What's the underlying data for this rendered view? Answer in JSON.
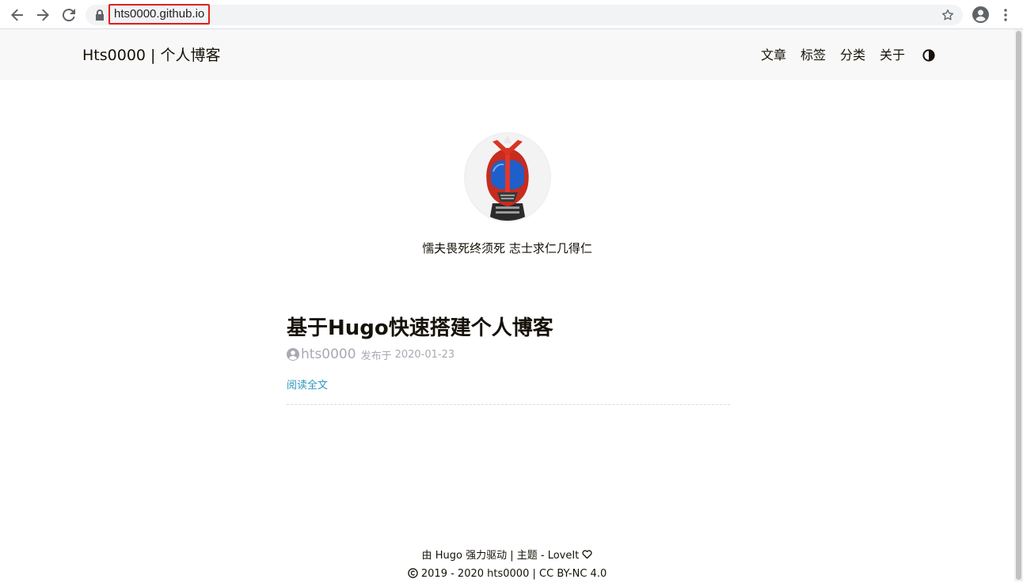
{
  "browser": {
    "url": "hts0000.github.io"
  },
  "header": {
    "site_title": "Hts0000 | 个人博客",
    "menu": [
      {
        "label": "文章"
      },
      {
        "label": "标签"
      },
      {
        "label": "分类"
      },
      {
        "label": "关于"
      }
    ]
  },
  "profile": {
    "subtitle": "懦夫畏死终须死 志士求仁几得仁"
  },
  "post": {
    "title": "基于Hugo快速搭建个人博客",
    "author": "hts0000",
    "published_prefix": "发布于",
    "date": "2020-01-23",
    "read_more": "阅读全文"
  },
  "footer": {
    "powered_prefix": "由 ",
    "hugo": "Hugo",
    "powered_suffix": " 强力驱动 | 主题 - ",
    "theme": "LoveIt",
    "years": "2019 - 2020",
    "owner": "hts0000",
    "license": "CC BY-NC 4.0"
  },
  "colors": {
    "url_highlight": "#e0201b",
    "link": "#2d96bd",
    "meta": "#a9a9b3",
    "header_bg": "#f8f8f8"
  }
}
